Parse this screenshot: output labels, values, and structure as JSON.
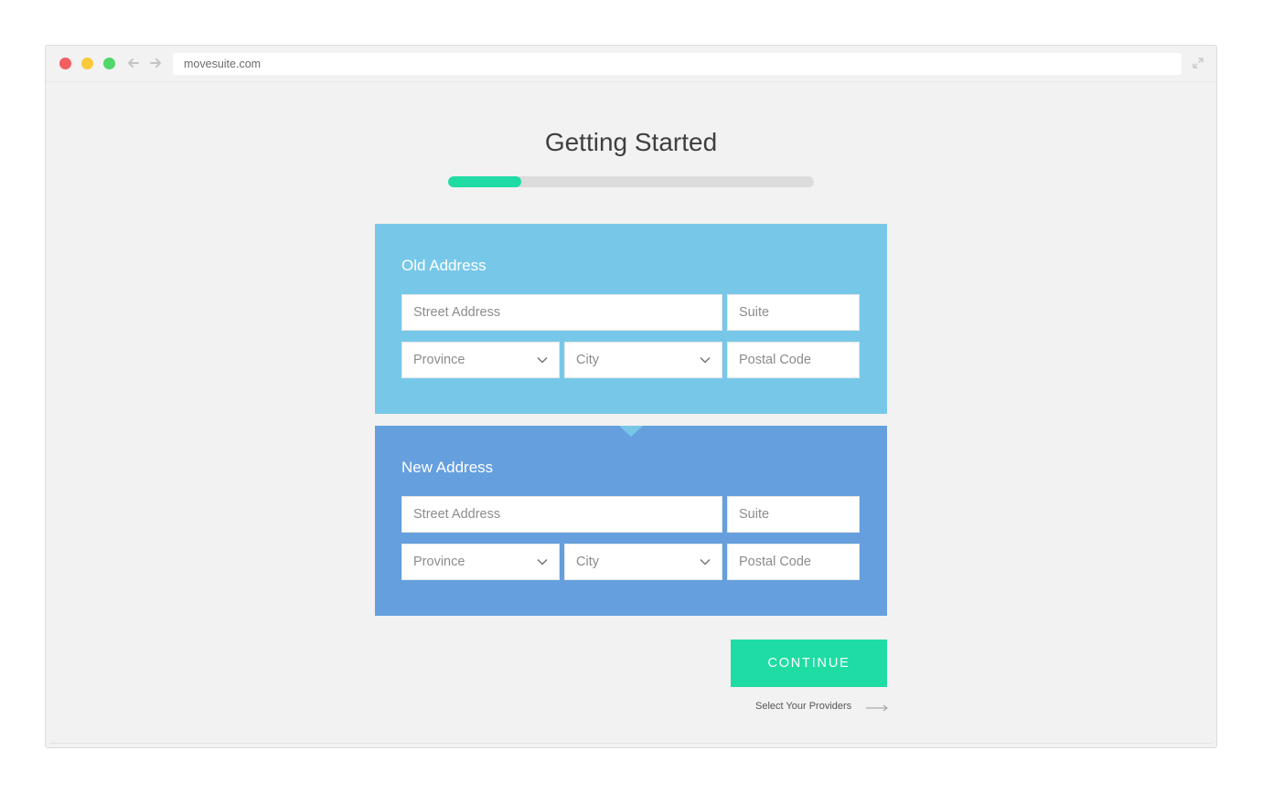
{
  "browser": {
    "url": "movesuite.com"
  },
  "page": {
    "title": "Getting Started",
    "progress_fraction": 0.2
  },
  "old_address": {
    "heading": "Old Address",
    "street_placeholder": "Street Address",
    "suite_placeholder": "Suite",
    "province_placeholder": "Province",
    "city_placeholder": "City",
    "postal_placeholder": "Postal Code"
  },
  "new_address": {
    "heading": "New Address",
    "street_placeholder": "Street Address",
    "suite_placeholder": "Suite",
    "province_placeholder": "Province",
    "city_placeholder": "City",
    "postal_placeholder": "Postal Code"
  },
  "actions": {
    "continue_label": "CONTINUE",
    "next_step_label": "Select Your Providers"
  },
  "colors": {
    "accent": "#1fdca5",
    "old_panel": "#77c8e8",
    "new_panel": "#659fdd",
    "progress_track": "#dcdcdc"
  },
  "icons": {
    "back": "arrow-left-icon",
    "forward": "arrow-right-icon",
    "expand": "expand-icon",
    "dropdown": "chevron-down-icon",
    "next": "long-arrow-right-icon"
  }
}
